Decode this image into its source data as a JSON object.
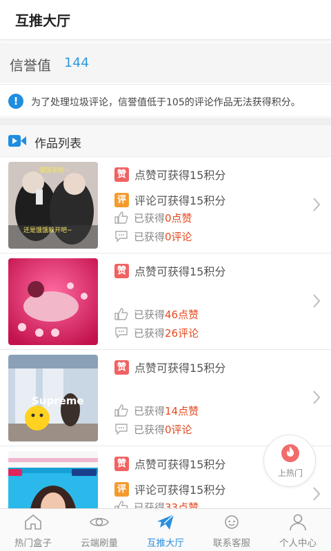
{
  "header": {
    "title": "互推大厅"
  },
  "credit": {
    "label": "信誉值",
    "value": "144"
  },
  "notice": {
    "icon": "info-icon",
    "text": "为了处理垃圾评论，信誉值低于105的评论作品无法获得积分。"
  },
  "section": {
    "icon": "video-icon",
    "title": "作品列表"
  },
  "items": [
    {
      "like_badge": "赞",
      "like_reward": "点赞可获得15积分",
      "comment_badge": "评",
      "comment_reward": "评论可获得15积分",
      "likes_prefix": "已获得",
      "likes_value": "0点赞",
      "comments_prefix": "已获得",
      "comments_value": "0评论",
      "thumb_caption_top": "饿饭来啦~",
      "thumb_caption_bottom": "还是饿饿躲开吧~"
    },
    {
      "like_badge": "赞",
      "like_reward": "点赞可获得15积分",
      "likes_prefix": "已获得",
      "likes_value": "46点赞",
      "comments_prefix": "已获得",
      "comments_value": "26评论"
    },
    {
      "like_badge": "赞",
      "like_reward": "点赞可获得15积分",
      "likes_prefix": "已获得",
      "likes_value": "14点赞",
      "comments_prefix": "已获得",
      "comments_value": "0评论",
      "thumb_caption": "Supreme"
    },
    {
      "like_badge": "赞",
      "like_reward": "点赞可获得15积分",
      "comment_badge": "评",
      "comment_reward": "评论可获得15积分",
      "likes_prefix": "已获得",
      "likes_value": "33点赞"
    }
  ],
  "fab": {
    "icon": "flame-icon",
    "label": "上热门"
  },
  "tabs": [
    {
      "label": "热门盒子",
      "icon": "home-icon",
      "active": false
    },
    {
      "label": "云端刷量",
      "icon": "eye-icon",
      "active": false
    },
    {
      "label": "互推大厅",
      "icon": "paper-plane-icon",
      "active": true
    },
    {
      "label": "联系客服",
      "icon": "headset-icon",
      "active": false
    },
    {
      "label": "个人中心",
      "icon": "person-icon",
      "active": false
    }
  ],
  "colors": {
    "accent": "#2b8fe0",
    "like_badge": "#f06262",
    "comment_badge": "#f39b2f",
    "highlight": "#e4491f"
  }
}
